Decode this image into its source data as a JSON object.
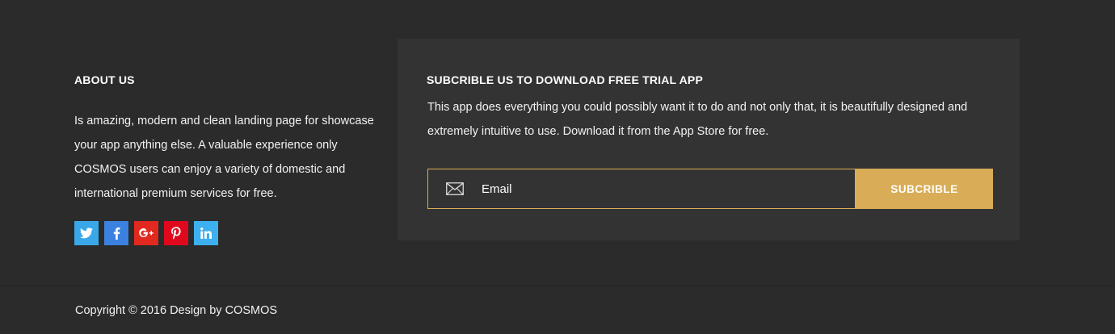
{
  "about": {
    "title": "ABOUT US",
    "text": "Is amazing, modern and clean landing page for showcase your app anything else.  A  valuable experience only COSMOS users can enjoy a variety of domestic and international premium services for free."
  },
  "socials": [
    {
      "icon": "twitter-icon",
      "color": "#3aa8e8",
      "glyph": "t"
    },
    {
      "icon": "facebook-icon",
      "color": "#3b82e0",
      "glyph": "f"
    },
    {
      "icon": "google-plus-icon",
      "color": "#e2291f",
      "glyph": "g+"
    },
    {
      "icon": "pinterest-icon",
      "color": "#e0081d",
      "glyph": "p"
    },
    {
      "icon": "linkedin-icon",
      "color": "#3db0f0",
      "glyph": "in"
    }
  ],
  "subscribe": {
    "title": "SUBCRIBLE US TO DOWNLOAD FREE TRIAL APP",
    "text": "This app does everything you could possibly want it to do and not only that, it is beautifully designed and extremely intuitive to use.  Download it from the App Store for free.",
    "email_placeholder": "Email",
    "button_label": "SUBCRIBLE",
    "accent_color": "#d9ad57"
  },
  "footer": {
    "copyright": "Copyright ©  2016 Design by COSMOS"
  }
}
